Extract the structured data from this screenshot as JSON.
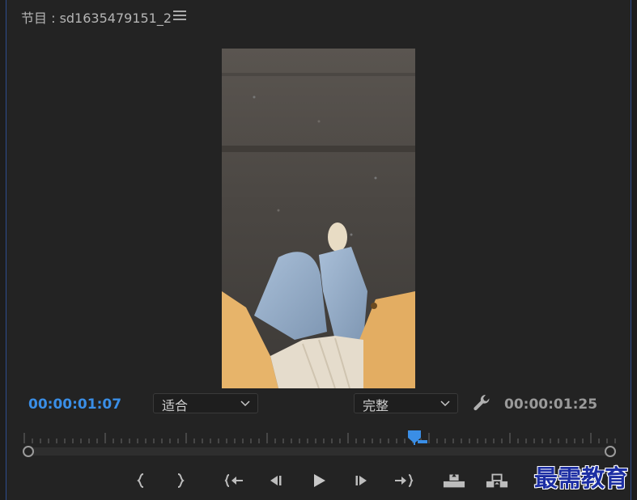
{
  "panel": {
    "title": "节目 : sd1635479151_2",
    "menu_icon": "hamburger-menu-icon"
  },
  "monitor": {
    "current_timecode": "00:00:01:07",
    "duration_timecode": "00:00:01:25",
    "zoom": {
      "value": "适合"
    },
    "quality": {
      "value": "完整"
    },
    "settings_icon": "wrench-icon",
    "playhead_position_fraction": 0.66
  },
  "transport_controls": [
    {
      "name": "mark-in-icon"
    },
    {
      "name": "mark-out-icon"
    },
    {
      "name": "go-to-in-icon"
    },
    {
      "name": "step-back-icon"
    },
    {
      "name": "play-icon"
    },
    {
      "name": "step-forward-icon"
    },
    {
      "name": "go-to-out-icon"
    },
    {
      "name": "lift-icon"
    },
    {
      "name": "extract-icon"
    }
  ],
  "watermark": {
    "text": "最需教育"
  },
  "colors": {
    "accent": "#3a8ee6",
    "panel_bg": "#232323",
    "panel_border": "#2e4d8f",
    "watermark": "#1c2ea3"
  }
}
